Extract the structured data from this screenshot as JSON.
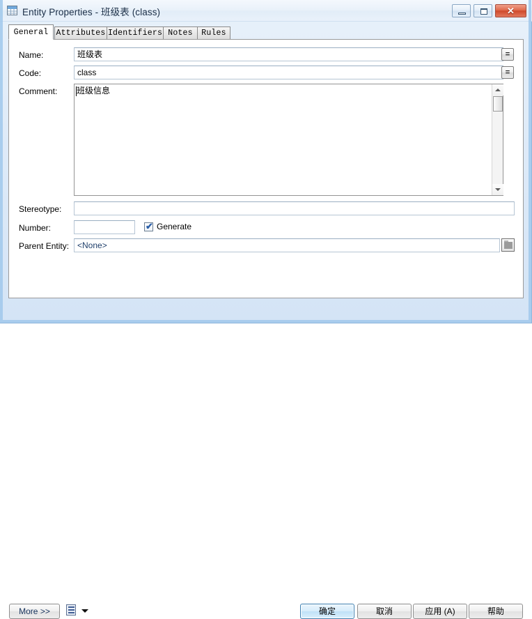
{
  "window": {
    "title": "Entity Properties - 班级表 (class)",
    "icon": "table-entity-icon",
    "minimize_label": "Minimize",
    "maximize_label": "Maximize",
    "close_label": "✕"
  },
  "tabs": [
    {
      "label": "General",
      "active": true
    },
    {
      "label": "Attributes",
      "active": false
    },
    {
      "label": "Identifiers",
      "active": false
    },
    {
      "label": "Notes",
      "active": false
    },
    {
      "label": "Rules",
      "active": false
    }
  ],
  "form": {
    "name": {
      "label": "Name:",
      "value": "班级表",
      "button_label": "="
    },
    "code": {
      "label": "Code:",
      "value": "class",
      "button_label": "="
    },
    "comment": {
      "label": "Comment:",
      "value": "班级信息"
    },
    "stereotype": {
      "label": "Stereotype:",
      "value": ""
    },
    "number": {
      "label": "Number:",
      "value": ""
    },
    "generate": {
      "label": "Generate",
      "checked": true,
      "tick": "✔"
    },
    "parent_entity": {
      "label": "Parent Entity:",
      "value": "<None>"
    }
  },
  "footer": {
    "more_label": "More >>",
    "report_icon": "report-list-icon",
    "ok_label": "确定",
    "cancel_label": "取消",
    "apply_label": "应用 (A)",
    "help_label": "帮助"
  },
  "colors": {
    "titlebar": "#e9f1fa",
    "frame": "#a0c8eb",
    "panel": "#ffffff",
    "default_button_border": "#3c7fb1",
    "close_button": "#cf4a2c"
  }
}
